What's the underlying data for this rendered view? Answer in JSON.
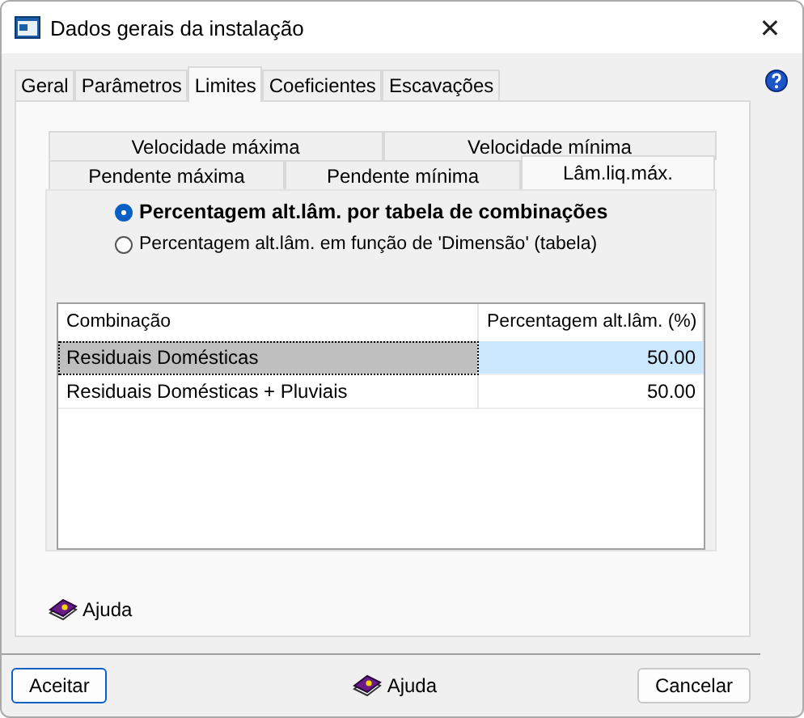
{
  "window": {
    "title": "Dados gerais da instalação",
    "close": "✕"
  },
  "tabs": [
    {
      "label": "Geral",
      "selected": false
    },
    {
      "label": "Parâmetros",
      "selected": false
    },
    {
      "label": "Limites",
      "selected": true
    },
    {
      "label": "Coeficientes",
      "selected": false
    },
    {
      "label": "Escavações",
      "selected": false
    }
  ],
  "inner_tabs": [
    [
      {
        "label": "Velocidade máxima",
        "selected": false
      },
      {
        "label": "Velocidade mínima",
        "selected": false
      }
    ],
    [
      {
        "label": "Pendente máxima",
        "selected": false
      },
      {
        "label": "Pendente mínima",
        "selected": false
      },
      {
        "label": "Lâm.liq.máx.",
        "selected": true
      }
    ]
  ],
  "options": [
    {
      "label": "Percentagem alt.lâm. por tabela de combinações",
      "selected": true
    },
    {
      "label": "Percentagem alt.lâm. em função de 'Dimensão' (tabela)",
      "selected": false
    }
  ],
  "table": {
    "columns": [
      "Combinação",
      "Percentagem alt.lâm. (%)"
    ],
    "rows": [
      {
        "cells": [
          "Residuais Domésticas",
          "50.00"
        ],
        "selected": true
      },
      {
        "cells": [
          "Residuais Domésticas + Pluviais",
          "50.00"
        ],
        "selected": false
      }
    ]
  },
  "panel_help": "Ajuda",
  "buttons": {
    "ok": "Aceitar",
    "help": "Ajuda",
    "cancel": "Cancelar"
  }
}
